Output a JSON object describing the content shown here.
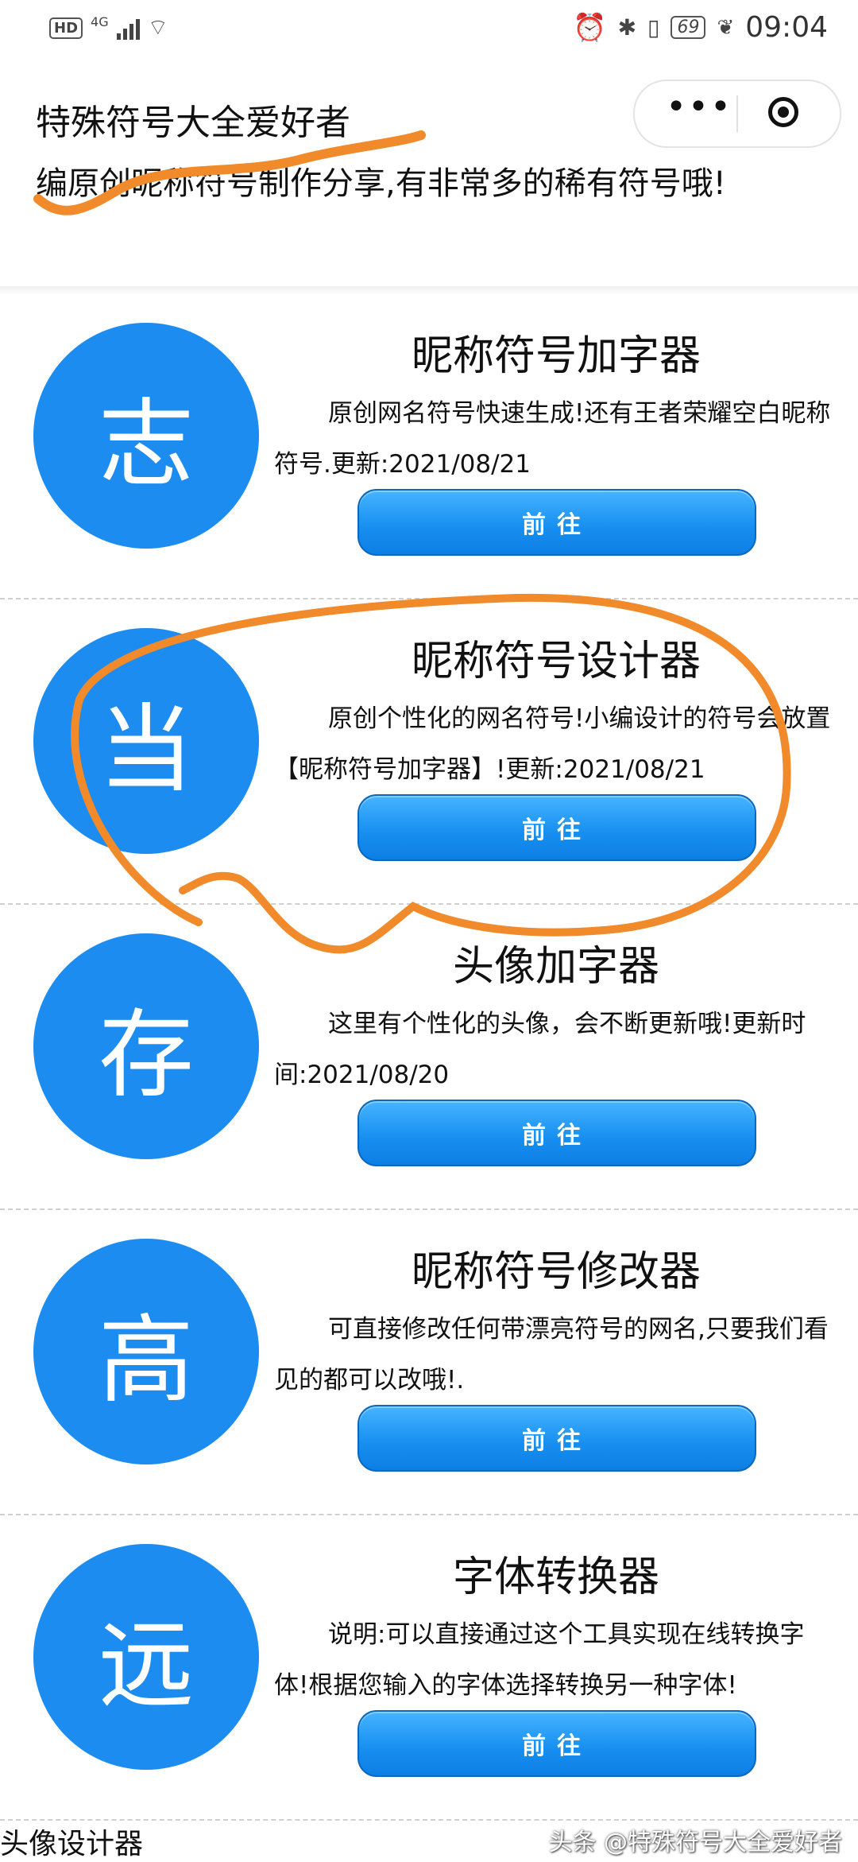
{
  "status_bar": {
    "network": "4G",
    "hd": "HD",
    "battery": "69",
    "time": "09:04"
  },
  "header": {
    "title": "特殊符号大全爱好者",
    "subtitle": "编原创昵称符号制作分享,有非常多的稀有符号哦!",
    "capsule_more": "•••"
  },
  "cards": [
    {
      "char": "志",
      "title": "昵称符号加字器",
      "desc": "原创网名符号快速生成!还有王者荣耀空白昵称符号.更新:2021/08/21",
      "button": "前往"
    },
    {
      "char": "当",
      "title": "昵称符号设计器",
      "desc": "原创个性化的网名符号!小编设计的符号会放置【昵称符号加字器】!更新:2021/08/21",
      "button": "前往"
    },
    {
      "char": "存",
      "title": "头像加字器",
      "desc": "这里有个性化的头像，会不断更新哦!更新时间:2021/08/20",
      "button": "前往"
    },
    {
      "char": "高",
      "title": "昵称符号修改器",
      "desc": "可直接修改任何带漂亮符号的网名,只要我们看见的都可以改哦!.",
      "button": "前往"
    },
    {
      "char": "远",
      "title": "字体转换器",
      "desc": "说明:可以直接通过这个工具实现在线转换字体!根据您输入的字体选择转换另一种字体!",
      "button": "前往"
    }
  ],
  "footer": {
    "next_label": "头像设计器",
    "watermark": "头条 @特殊符号大全爱好者"
  },
  "colors": {
    "accent": "#1c8cf0",
    "annotation": "#f08a2a"
  }
}
